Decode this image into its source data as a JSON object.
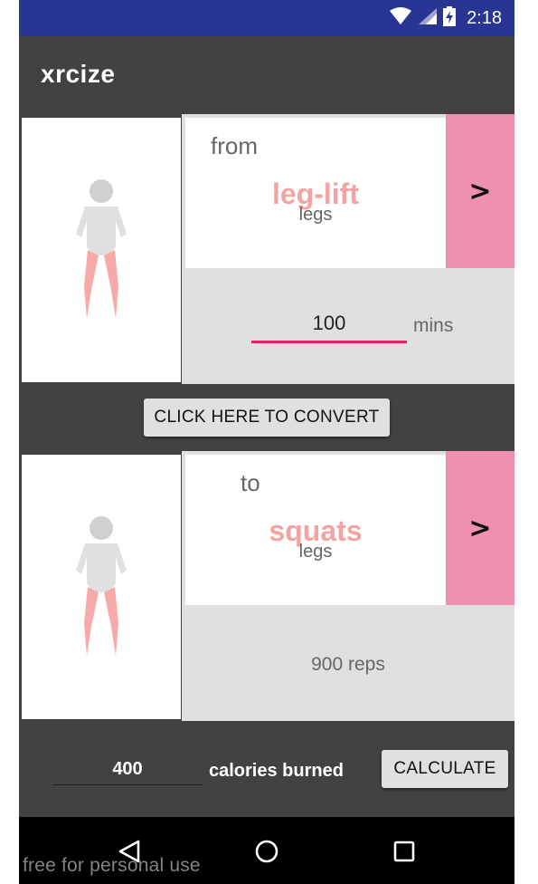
{
  "status_bar": {
    "time": "2:18",
    "icons": [
      "wifi-icon",
      "cell-signal-icon",
      "battery-charging-icon"
    ]
  },
  "app_bar": {
    "title": "xrcize"
  },
  "from_panel": {
    "direction_label": "from",
    "exercise_name": "leg-lift",
    "muscle_group": "legs",
    "next_label": ">",
    "duration_value": "100",
    "duration_unit": "mins"
  },
  "convert_button": {
    "label": "CLICK HERE TO CONVERT"
  },
  "to_panel": {
    "direction_label": "to",
    "exercise_name": "squats",
    "muscle_group": "legs",
    "next_label": ">",
    "result_text": "900 reps"
  },
  "calc": {
    "calories_value": "400",
    "calories_label": "calories burned",
    "button_label": "CALCULATE"
  },
  "nav": {
    "icons": [
      "back-triangle-icon",
      "home-circle-icon",
      "recents-square-icon"
    ]
  },
  "watermark": "free for personal use",
  "colors": {
    "status_bar": "#283593",
    "app_bar": "#424242",
    "accent_pink": "#f090b0",
    "exercise_name": "#f4a3a3",
    "input_underline": "#e91e63"
  }
}
